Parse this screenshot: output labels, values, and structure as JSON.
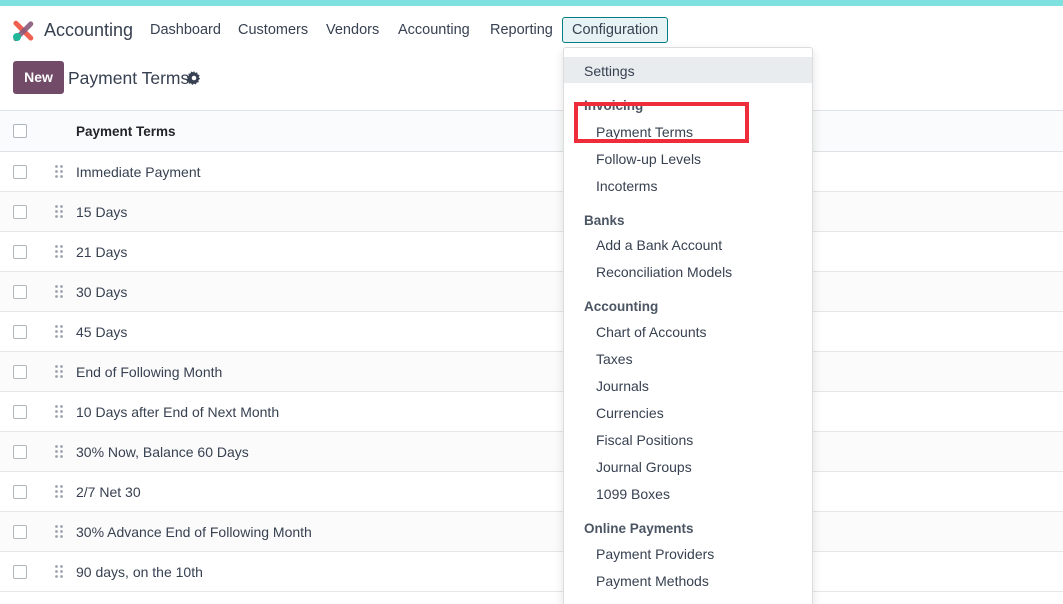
{
  "navbar": {
    "app_name": "Accounting",
    "items": [
      "Dashboard",
      "Customers",
      "Vendors",
      "Accounting",
      "Reporting"
    ],
    "active_item": "Configuration"
  },
  "controlpanel": {
    "new_label": "New",
    "title": "Payment Terms"
  },
  "table": {
    "header": "Payment Terms",
    "rows": [
      "Immediate Payment",
      "15 Days",
      "21 Days",
      "30 Days",
      "45 Days",
      "End of Following Month",
      "10 Days after End of Next Month",
      "30% Now, Balance 60 Days",
      "2/7 Net 30",
      "30% Advance End of Following Month",
      "90 days, on the 10th"
    ]
  },
  "dropdown": {
    "settings": "Settings",
    "sections": [
      {
        "header": "Invoicing",
        "items": [
          "Payment Terms",
          "Follow-up Levels",
          "Incoterms"
        ]
      },
      {
        "header": "Banks",
        "items": [
          "Add a Bank Account",
          "Reconciliation Models"
        ]
      },
      {
        "header": "Accounting",
        "items": [
          "Chart of Accounts",
          "Taxes",
          "Journals",
          "Currencies",
          "Fiscal Positions",
          "Journal Groups",
          "1099 Boxes"
        ]
      },
      {
        "header": "Online Payments",
        "items": [
          "Payment Providers",
          "Payment Methods"
        ]
      }
    ]
  },
  "colors": {
    "primary": "#714b67",
    "accent": "#017e84",
    "highlight": "#ef2d3a"
  }
}
